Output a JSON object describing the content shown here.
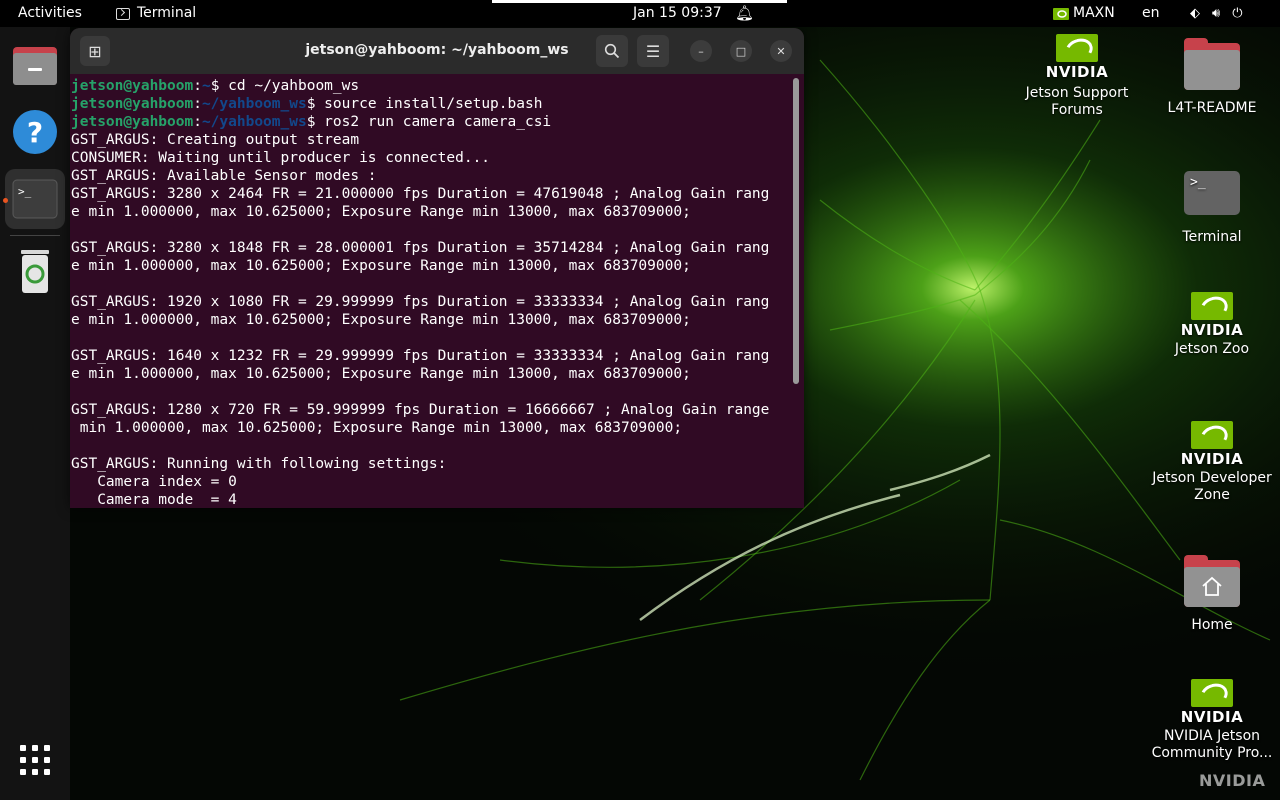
{
  "topbar": {
    "activities": "Activities",
    "app_name": "Terminal",
    "clock": "Jan 15  09:37",
    "power_mode": "MAXN",
    "language": "en"
  },
  "dock": {
    "items": [
      "files-icon",
      "help-icon",
      "terminal-icon",
      "trash-icon",
      "show-apps-icon"
    ]
  },
  "terminal": {
    "title": "jetson@yahboom: ~/yahboom_ws",
    "prompts": [
      {
        "user": "jetson@yahboom",
        "path": "~",
        "cmd": " cd ~/yahboom_ws"
      },
      {
        "user": "jetson@yahboom",
        "path": "~/yahboom_ws",
        "cmd": " source install/setup.bash"
      },
      {
        "user": "jetson@yahboom",
        "path": "~/yahboom_ws",
        "cmd": " ros2 run camera camera_csi"
      }
    ],
    "output": [
      "GST_ARGUS: Creating output stream",
      "CONSUMER: Waiting until producer is connected...",
      "GST_ARGUS: Available Sensor modes :",
      "GST_ARGUS: 3280 x 2464 FR = 21.000000 fps Duration = 47619048 ; Analog Gain rang",
      "e min 1.000000, max 10.625000; Exposure Range min 13000, max 683709000;",
      "",
      "GST_ARGUS: 3280 x 1848 FR = 28.000001 fps Duration = 35714284 ; Analog Gain rang",
      "e min 1.000000, max 10.625000; Exposure Range min 13000, max 683709000;",
      "",
      "GST_ARGUS: 1920 x 1080 FR = 29.999999 fps Duration = 33333334 ; Analog Gain rang",
      "e min 1.000000, max 10.625000; Exposure Range min 13000, max 683709000;",
      "",
      "GST_ARGUS: 1640 x 1232 FR = 29.999999 fps Duration = 33333334 ; Analog Gain rang",
      "e min 1.000000, max 10.625000; Exposure Range min 13000, max 683709000;",
      "",
      "GST_ARGUS: 1280 x 720 FR = 59.999999 fps Duration = 16666667 ; Analog Gain range",
      " min 1.000000, max 10.625000; Exposure Range min 13000, max 683709000;",
      "",
      "GST_ARGUS: Running with following settings:",
      "   Camera index = 0",
      "   Camera mode  = 4"
    ]
  },
  "desktop": {
    "icons": [
      {
        "label": "Jetson Support Forums",
        "kind": "nvidia"
      },
      {
        "label": "L4T-README",
        "kind": "folder"
      },
      {
        "label": "Terminal",
        "kind": "terminal"
      },
      {
        "label": "Jetson Zoo",
        "kind": "nvidia"
      },
      {
        "label": "Jetson Developer Zone",
        "kind": "nvidia"
      },
      {
        "label": "Home",
        "kind": "home-folder"
      },
      {
        "label": "NVIDIA Jetson Community Pro...",
        "kind": "nvidia"
      }
    ],
    "nvidia_text": "NVIDIA",
    "watermark": "NVIDIA"
  },
  "colors": {
    "terminal_bg": "#300a24",
    "prompt_user": "#26a269",
    "prompt_path": "#12488b",
    "nvidia_green": "#76b900",
    "folder_red": "#c7424b"
  }
}
